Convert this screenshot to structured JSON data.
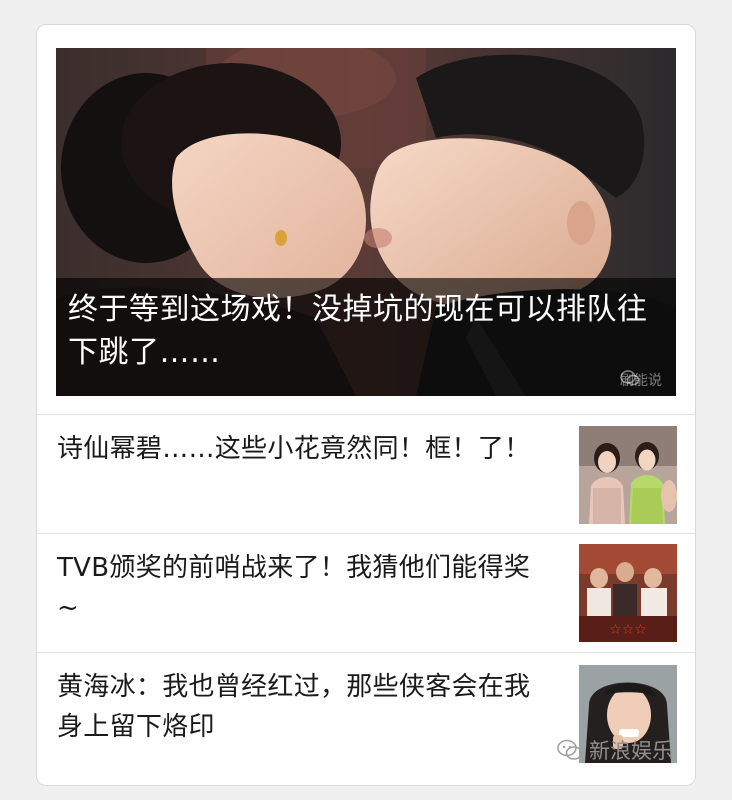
{
  "hero": {
    "title": "终于等到这场戏！没掉坑的现在可以排队往下跳了……",
    "watermark": "剧能说",
    "image": "couple-kiss-photo"
  },
  "articles": [
    {
      "title": "诗仙幂碧……这些小花竟然同！框！了！",
      "thumb": "two-actresses-photo"
    },
    {
      "title": "TVB颁奖的前哨战来了！我猜他们能得奖~",
      "thumb": "tvb-poster-photo"
    },
    {
      "title": "黄海冰：我也曾经红过，那些侠客会在我身上留下烙印",
      "thumb": "actor-portrait-photo"
    }
  ],
  "footer": {
    "brand": "新浪娱乐",
    "icon": "wechat-icon"
  }
}
